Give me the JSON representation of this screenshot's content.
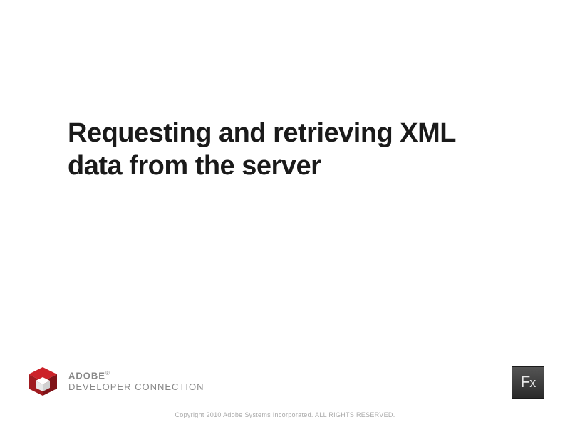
{
  "title": "Requesting and retrieving XML data from the server",
  "brand": {
    "line1": "ADOBE",
    "registered": "®",
    "line2": "DEVELOPER CONNECTION"
  },
  "badge": {
    "letter1": "F",
    "letter2": "x"
  },
  "copyright": "Copyright 2010 Adobe Systems Incorporated. ALL RIGHTS RESERVED."
}
